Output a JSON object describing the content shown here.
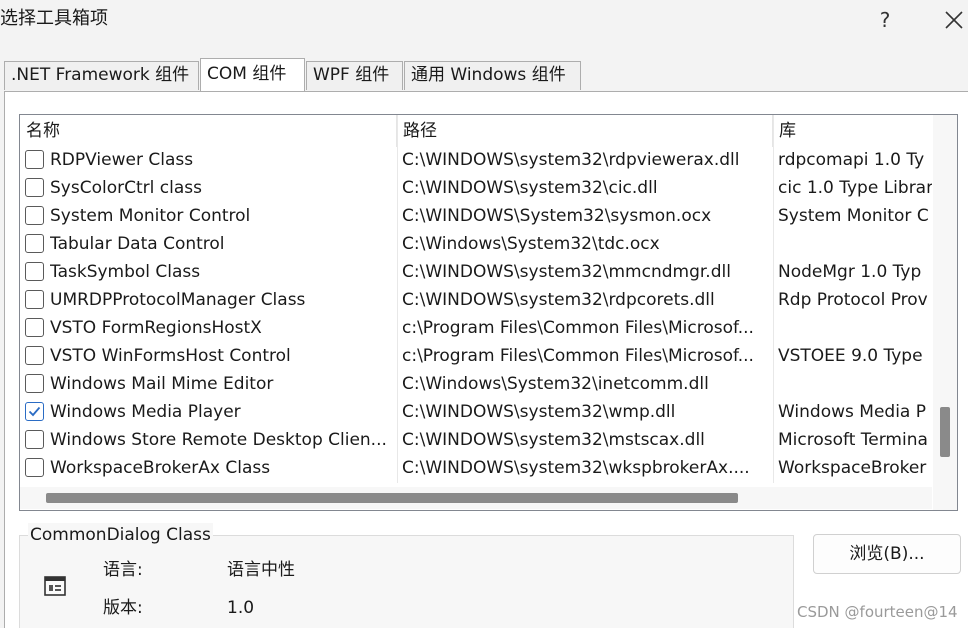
{
  "window": {
    "title": "选择工具箱项",
    "help_label": "?"
  },
  "tabs": [
    {
      "label": ".NET Framework 组件",
      "active": false
    },
    {
      "label": "COM 组件",
      "active": true
    },
    {
      "label": "WPF 组件",
      "active": false
    },
    {
      "label": "通用 Windows 组件",
      "active": false
    }
  ],
  "list": {
    "columns": [
      "名称",
      "路径",
      "库"
    ],
    "rows": [
      {
        "name": "RDPViewer Class",
        "path": "C:\\WINDOWS\\system32\\rdpviewerax.dll",
        "library": "rdpcomapi 1.0 Ty",
        "checked": false
      },
      {
        "name": "SysColorCtrl class",
        "path": "C:\\WINDOWS\\system32\\cic.dll",
        "library": "cic 1.0 Type Librar",
        "checked": false
      },
      {
        "name": "System Monitor Control",
        "path": "C:\\WINDOWS\\System32\\sysmon.ocx",
        "library": "System Monitor C",
        "checked": false
      },
      {
        "name": "Tabular Data Control",
        "path": "C:\\Windows\\System32\\tdc.ocx",
        "library": "",
        "checked": false
      },
      {
        "name": "TaskSymbol Class",
        "path": "C:\\WINDOWS\\system32\\mmcndmgr.dll",
        "library": "NodeMgr 1.0 Typ",
        "checked": false
      },
      {
        "name": "UMRDPProtocolManager  Class",
        "path": "C:\\WINDOWS\\system32\\rdpcorets.dll",
        "library": "Rdp Protocol Prov",
        "checked": false
      },
      {
        "name": "VSTO FormRegionsHostX",
        "path": "c:\\Program Files\\Common Files\\Microsof...",
        "library": "",
        "checked": false
      },
      {
        "name": "VSTO WinFormsHost Control",
        "path": "c:\\Program Files\\Common Files\\Microsof...",
        "library": "VSTOEE 9.0 Type",
        "checked": false
      },
      {
        "name": "Windows Mail Mime Editor",
        "path": "C:\\Windows\\System32\\inetcomm.dll",
        "library": "",
        "checked": false
      },
      {
        "name": "Windows Media Player",
        "path": "C:\\WINDOWS\\system32\\wmp.dll",
        "library": "Windows Media P",
        "checked": true
      },
      {
        "name": "Windows Store Remote Desktop Clien...",
        "path": "C:\\WINDOWS\\system32\\mstscax.dll",
        "library": "Microsoft Termina",
        "checked": false
      },
      {
        "name": "WorkspaceBrokerAx Class",
        "path": "C:\\WINDOWS\\system32\\wkspbrokerAx....",
        "library": "WorkspaceBroker",
        "checked": false
      }
    ]
  },
  "details": {
    "group_title": "CommonDialog Class",
    "language_label": "语言:",
    "language_value": "语言中性",
    "version_label": "版本:",
    "version_value": "1.0"
  },
  "browse_label": "浏览(B)...",
  "watermark": "CSDN @fourteen@14",
  "colors": {
    "check_accent": "#2b6cc4",
    "scroll_thumb": "#8a8a8a"
  }
}
